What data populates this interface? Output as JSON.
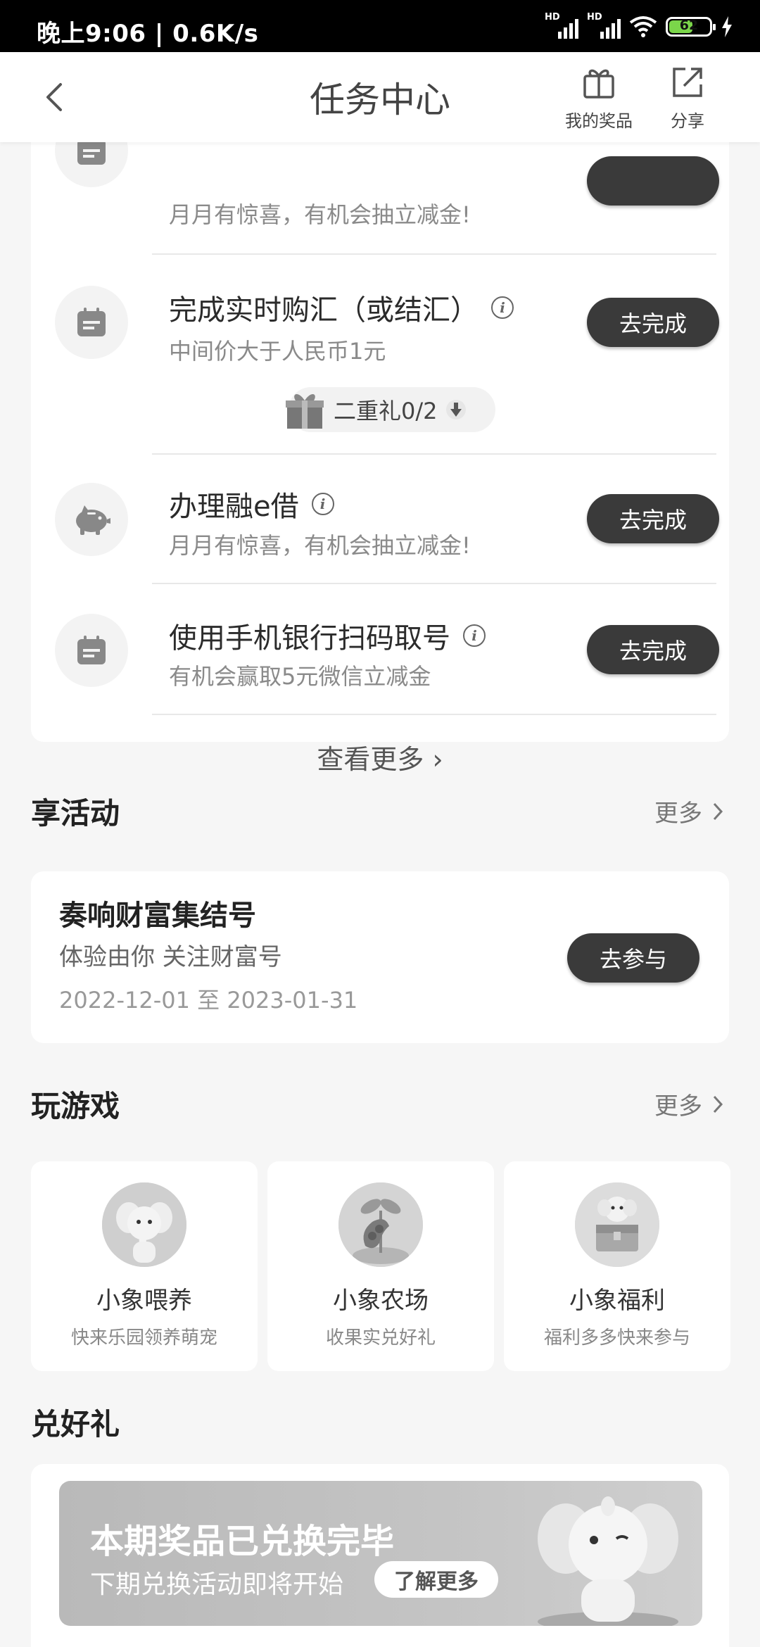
{
  "status_bar": {
    "time": "晚上9:06 | 0.6K/s",
    "battery": "62",
    "hd": "HD"
  },
  "header": {
    "title": "任务中心",
    "my_prize_label": "我的奖品",
    "share_label": "分享"
  },
  "tasks": [
    {
      "name": "",
      "desc": "月月有惊喜，有机会抽立减金!",
      "button": ""
    },
    {
      "name": "完成实时购汇（或结汇）",
      "desc": "中间价大于人民币1元",
      "button": "去完成",
      "gift": "二重礼0/2"
    },
    {
      "name": "办理融e借",
      "desc": "月月有惊喜，有机会抽立减金!",
      "button": "去完成"
    },
    {
      "name": "使用手机银行扫码取号",
      "desc": "有机会赢取5元微信立减金",
      "button": "去完成"
    }
  ],
  "see_more": "查看更多",
  "activity_section": {
    "title": "享活动",
    "more": "更多",
    "card": {
      "title": "奏响财富集结号",
      "subtitle": "体验由你 关注财富号",
      "date_range": "2022-12-01 至 2023-01-31",
      "button": "去参与"
    }
  },
  "games_section": {
    "title": "玩游戏",
    "more": "更多",
    "games": [
      {
        "name": "小象喂养",
        "desc": "快来乐园领养萌宠"
      },
      {
        "name": "小象农场",
        "desc": "收果实兑好礼"
      },
      {
        "name": "小象福利",
        "desc": "福利多多快来参与"
      }
    ]
  },
  "gift_section": {
    "title": "兑好礼",
    "banner_title": "本期奖品已兑换完毕",
    "banner_subtitle": "下期兑换活动即将开始",
    "banner_button": "了解更多"
  },
  "colors": {
    "button_dark": "#3a3a3a",
    "background": "#f6f6f6",
    "card": "#ffffff"
  }
}
